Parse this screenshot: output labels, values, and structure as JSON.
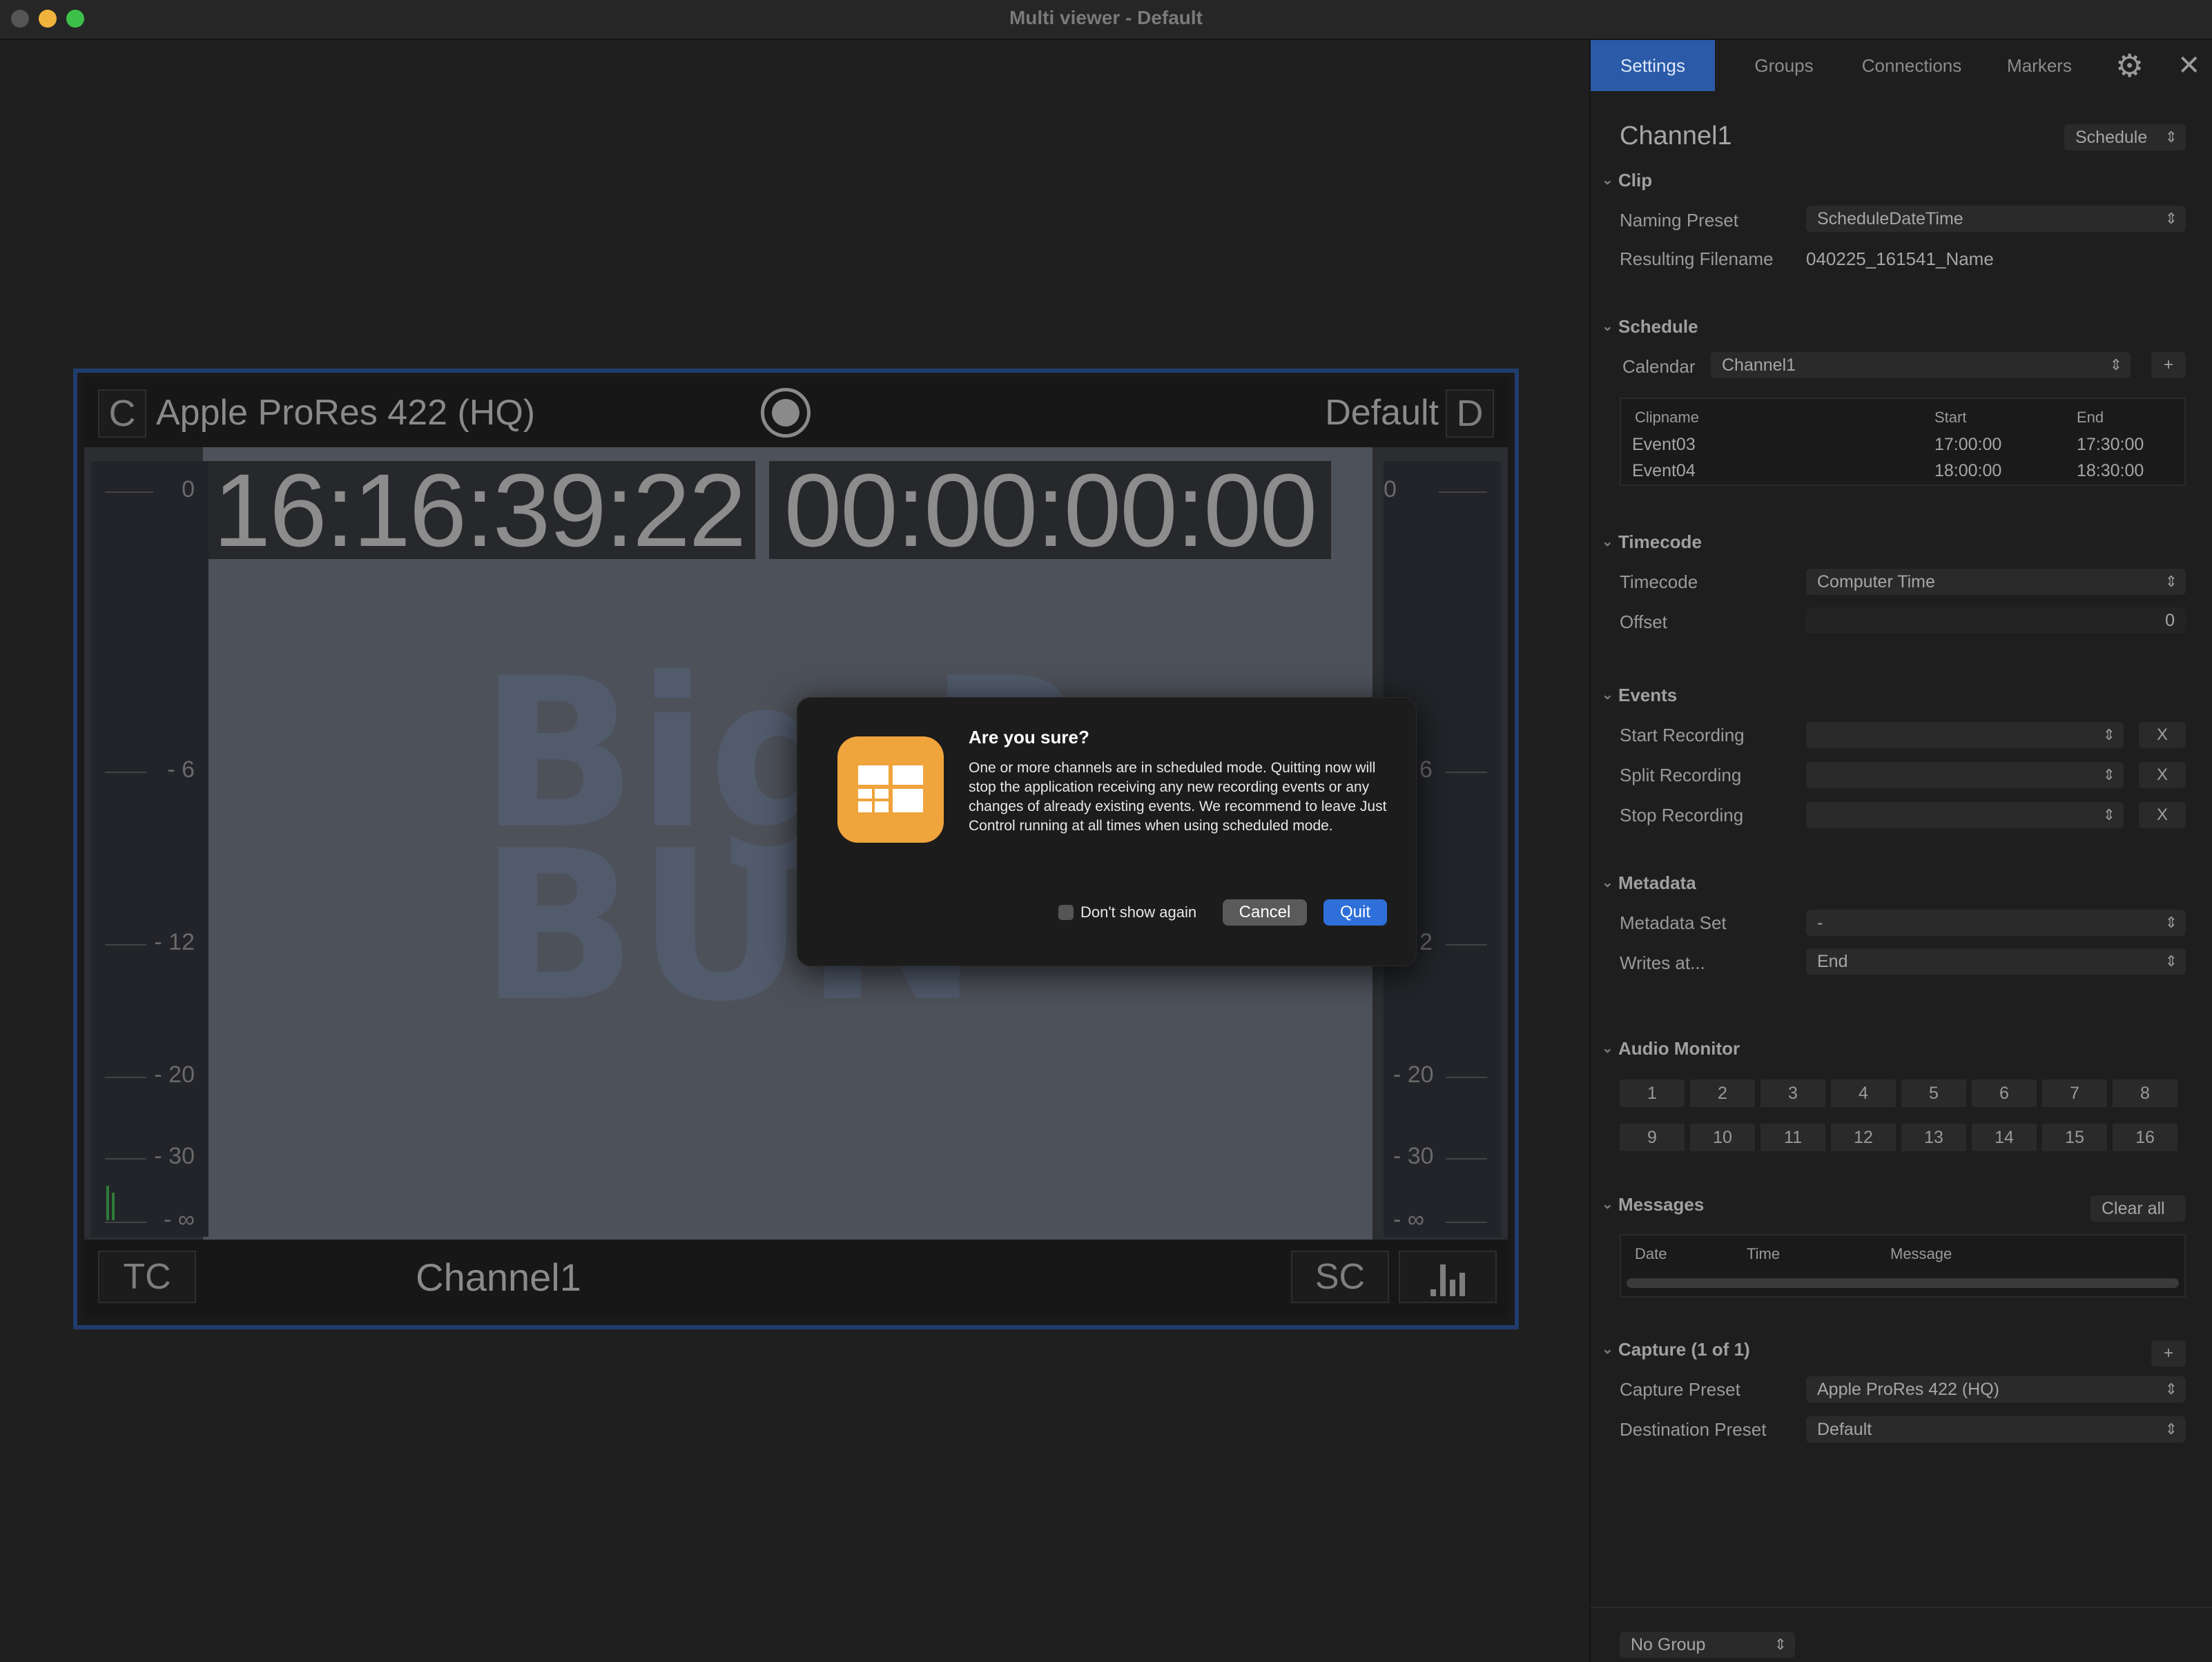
{
  "window": {
    "title": "Multi viewer - Default"
  },
  "monitor": {
    "codec": "Apple ProRes 422 (HQ)",
    "c_label": "C",
    "preset": "Default",
    "d_label": "D",
    "timecode": "16:16:39:22",
    "duration": "00:00:00:00",
    "channel": "Channel1",
    "tc_label": "TC",
    "sc_label": "SC",
    "video_text_1": "Big B",
    "video_text_2": "BUN",
    "meter_left": [
      "0",
      "- 6",
      "- 12",
      "- 20",
      "- 30",
      "- ∞"
    ],
    "meter_right": [
      "0",
      "6",
      "2",
      "- 20",
      "- 30",
      "- ∞"
    ]
  },
  "dialog": {
    "title": "Are you sure?",
    "message": "One or more channels are in scheduled mode. Quitting now will stop the application receiving any new recording events or any changes of already existing events. We recommend to leave Just Control running at all times when using scheduled mode.",
    "checkbox_label": "Don't show again",
    "cancel": "Cancel",
    "quit": "Quit"
  },
  "sidebar": {
    "tabs": [
      "Settings",
      "Groups",
      "Connections",
      "Markers"
    ],
    "channel_title": "Channel1",
    "mode": "Schedule",
    "clip": {
      "section": "Clip",
      "naming_preset_label": "Naming Preset",
      "naming_preset": "ScheduleDateTime",
      "resulting_label": "Resulting Filename",
      "resulting": "040225_161541_Name"
    },
    "schedule": {
      "section": "Schedule",
      "calendar_label": "Calendar",
      "calendar": "Channel1",
      "add": "+",
      "headers": [
        "Clipname",
        "Start",
        "End"
      ],
      "rows": [
        {
          "name": "Event03",
          "start": "17:00:00",
          "end": "17:30:00"
        },
        {
          "name": "Event04",
          "start": "18:00:00",
          "end": "18:30:00"
        }
      ]
    },
    "timecode": {
      "section": "Timecode",
      "timecode_label": "Timecode",
      "timecode": "Computer Time",
      "offset_label": "Offset",
      "offset": "0"
    },
    "events": {
      "section": "Events",
      "start_label": "Start Recording",
      "split_label": "Split Recording",
      "stop_label": "Stop Recording",
      "x": "X"
    },
    "metadata": {
      "section": "Metadata",
      "set_label": "Metadata Set",
      "set": "-",
      "writes_label": "Writes at...",
      "writes": "End"
    },
    "audio": {
      "section": "Audio Monitor",
      "row1": [
        "1",
        "2",
        "3",
        "4",
        "5",
        "6",
        "7",
        "8"
      ],
      "row2": [
        "9",
        "10",
        "11",
        "12",
        "13",
        "14",
        "15",
        "16"
      ]
    },
    "messages": {
      "section": "Messages",
      "clear": "Clear all",
      "headers": [
        "Date",
        "Time",
        "Message"
      ]
    },
    "capture": {
      "section": "Capture (1 of 1)",
      "add": "+",
      "capture_label": "Capture Preset",
      "capture": "Apple ProRes 422 (HQ)",
      "dest_label": "Destination Preset",
      "dest": "Default"
    },
    "group": "No Group"
  },
  "colors": {
    "accent": "#2a5aa8",
    "quit": "#2f6fd9",
    "icon": "#f0a43c",
    "monitor_border": "#203d6e"
  }
}
